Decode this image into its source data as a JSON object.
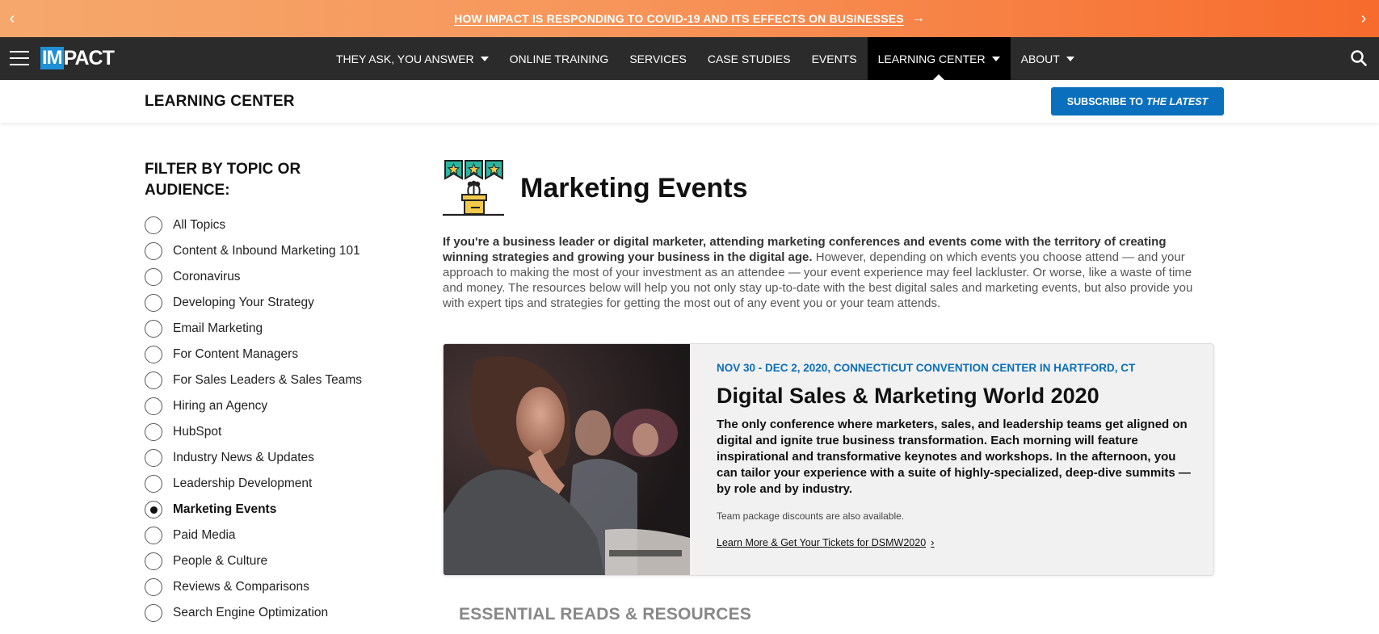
{
  "announcement": {
    "text": "HOW IMPACT IS RESPONDING TO COVID-19 AND ITS EFFECTS ON BUSINESSES",
    "arrow": "→",
    "prev": "‹",
    "next": "›"
  },
  "nav": {
    "logo_im": "IM",
    "logo_pact": "PACT",
    "items": [
      {
        "label": "THEY ASK, YOU ANSWER",
        "dropdown": true
      },
      {
        "label": "ONLINE TRAINING",
        "dropdown": false
      },
      {
        "label": "SERVICES",
        "dropdown": false
      },
      {
        "label": "CASE STUDIES",
        "dropdown": false
      },
      {
        "label": "EVENTS",
        "dropdown": false
      },
      {
        "label": "LEARNING CENTER",
        "dropdown": true,
        "active": true
      },
      {
        "label": "ABOUT",
        "dropdown": true
      }
    ]
  },
  "subheader": {
    "title": "LEARNING CENTER",
    "subscribe_prefix": "SUBSCRIBE TO",
    "subscribe_emphasis": "THE LATEST"
  },
  "sidebar": {
    "heading": "FILTER BY TOPIC OR AUDIENCE:",
    "filters": [
      {
        "label": "All Topics",
        "selected": false
      },
      {
        "label": "Content & Inbound Marketing 101",
        "selected": false
      },
      {
        "label": "Coronavirus",
        "selected": false
      },
      {
        "label": "Developing Your Strategy",
        "selected": false
      },
      {
        "label": "Email Marketing",
        "selected": false
      },
      {
        "label": "For Content Managers",
        "selected": false
      },
      {
        "label": "For Sales Leaders & Sales Teams",
        "selected": false
      },
      {
        "label": "Hiring an Agency",
        "selected": false
      },
      {
        "label": "HubSpot",
        "selected": false
      },
      {
        "label": "Industry News & Updates",
        "selected": false
      },
      {
        "label": "Leadership Development",
        "selected": false
      },
      {
        "label": "Marketing Events",
        "selected": true
      },
      {
        "label": "Paid Media",
        "selected": false
      },
      {
        "label": "People & Culture",
        "selected": false
      },
      {
        "label": "Reviews & Comparisons",
        "selected": false
      },
      {
        "label": "Search Engine Optimization",
        "selected": false
      }
    ]
  },
  "main": {
    "title": "Marketing Events",
    "intro_bold": "If you're a business leader or digital marketer, attending marketing conferences and events come with the territory of creating winning strategies and growing your business in the digital age.",
    "intro_rest": " However, depending on which events you choose attend — and your approach to making the most of your investment as an attendee — your event experience may feel lackluster. Or worse, like a waste of time and money. The resources below will help you not only stay up-to-date with the best digital sales and marketing events, but also provide you with expert tips and strategies for getting the most out of any event you or your team attends.",
    "featured": {
      "date": "NOV 30 - DEC 2, 2020, CONNECTICUT CONVENTION CENTER IN HARTFORD, CT",
      "title": "Digital Sales & Marketing World 2020",
      "description": "The only conference where marketers, sales, and leadership teams get aligned on digital and ignite true business transformation. Each morning will feature inspirational and transformative keynotes and workshops. In the afternoon, you can tailor your experience with a suite of highly-specialized, deep-dive summits — by role and by industry.",
      "note": "Team package discounts are also available.",
      "link": "Learn More & Get Your Tickets for DSMW2020",
      "link_chevron": "›"
    },
    "section_heading": "ESSENTIAL READS & RESOURCES"
  },
  "colors": {
    "accent_blue": "#0a6fbd",
    "nav_bg": "#2b2b2b",
    "banner_start": "#f6a86c",
    "banner_end": "#f76b2c"
  }
}
